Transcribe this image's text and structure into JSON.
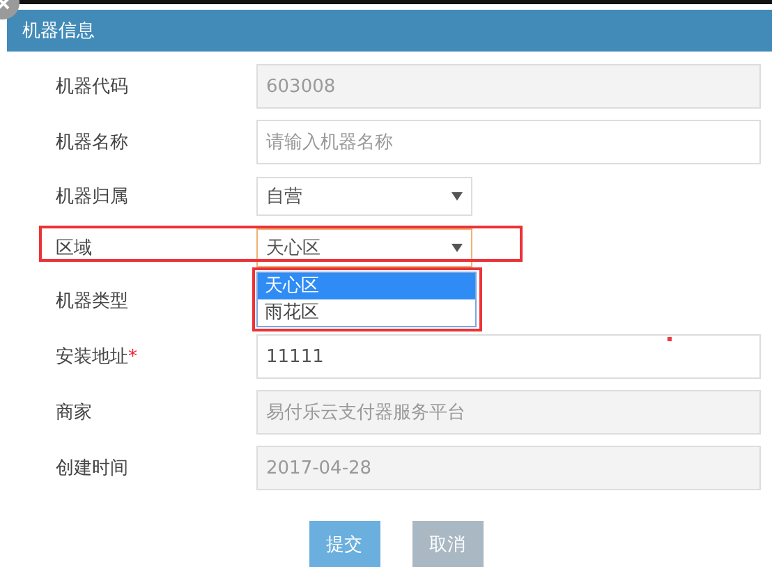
{
  "panel": {
    "title": "机器信息"
  },
  "fields": [
    {
      "label": "机器代码",
      "kind": "text",
      "value": "603008",
      "disabled": true
    },
    {
      "label": "机器名称",
      "kind": "text",
      "placeholder": "请输入机器名称",
      "disabled": false
    },
    {
      "label": "机器归属",
      "kind": "select",
      "value": "自营",
      "focused": false,
      "highlighted": false
    },
    {
      "label": "区域",
      "kind": "select",
      "value": "天心区",
      "focused": true,
      "highlighted": true,
      "dropdown": {
        "highlighted": true,
        "options": [
          {
            "label": "天心区",
            "selected": true
          },
          {
            "label": "雨花区",
            "selected": false
          }
        ]
      }
    },
    {
      "label": "机器类型",
      "kind": "covered"
    },
    {
      "label": "安装地址",
      "required": true,
      "required_mark": "*",
      "kind": "text",
      "value": "11111",
      "disabled": false
    },
    {
      "label": "商家",
      "kind": "text",
      "value": "易付乐云支付器服务平台",
      "disabled": true
    },
    {
      "label": "创建时间",
      "kind": "text",
      "value": "2017-04-28",
      "disabled": true
    }
  ],
  "buttons": [
    {
      "label": "提交",
      "kind": "primary"
    },
    {
      "label": "取消",
      "kind": "secondary"
    }
  ],
  "marks": [
    {
      "kind": "dot",
      "color": "#f03a3a"
    }
  ]
}
